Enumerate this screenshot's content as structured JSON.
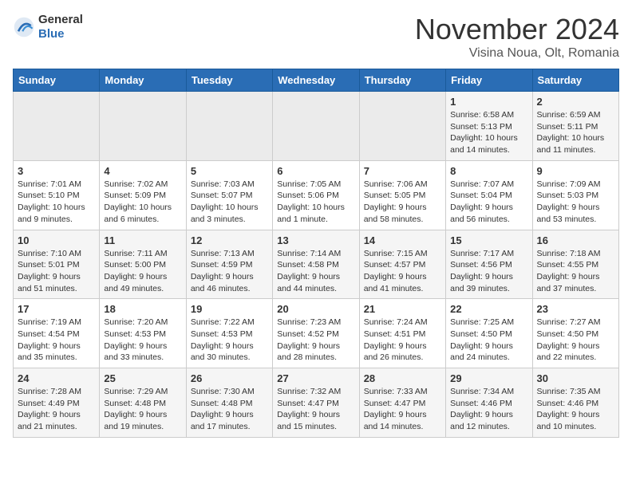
{
  "header": {
    "logo_general": "General",
    "logo_blue": "Blue",
    "title": "November 2024",
    "subtitle": "Visina Noua, Olt, Romania"
  },
  "days_of_week": [
    "Sunday",
    "Monday",
    "Tuesday",
    "Wednesday",
    "Thursday",
    "Friday",
    "Saturday"
  ],
  "weeks": [
    [
      {
        "day": "",
        "info": ""
      },
      {
        "day": "",
        "info": ""
      },
      {
        "day": "",
        "info": ""
      },
      {
        "day": "",
        "info": ""
      },
      {
        "day": "",
        "info": ""
      },
      {
        "day": "1",
        "info": "Sunrise: 6:58 AM\nSunset: 5:13 PM\nDaylight: 10 hours and 14 minutes."
      },
      {
        "day": "2",
        "info": "Sunrise: 6:59 AM\nSunset: 5:11 PM\nDaylight: 10 hours and 11 minutes."
      }
    ],
    [
      {
        "day": "3",
        "info": "Sunrise: 7:01 AM\nSunset: 5:10 PM\nDaylight: 10 hours and 9 minutes."
      },
      {
        "day": "4",
        "info": "Sunrise: 7:02 AM\nSunset: 5:09 PM\nDaylight: 10 hours and 6 minutes."
      },
      {
        "day": "5",
        "info": "Sunrise: 7:03 AM\nSunset: 5:07 PM\nDaylight: 10 hours and 3 minutes."
      },
      {
        "day": "6",
        "info": "Sunrise: 7:05 AM\nSunset: 5:06 PM\nDaylight: 10 hours and 1 minute."
      },
      {
        "day": "7",
        "info": "Sunrise: 7:06 AM\nSunset: 5:05 PM\nDaylight: 9 hours and 58 minutes."
      },
      {
        "day": "8",
        "info": "Sunrise: 7:07 AM\nSunset: 5:04 PM\nDaylight: 9 hours and 56 minutes."
      },
      {
        "day": "9",
        "info": "Sunrise: 7:09 AM\nSunset: 5:03 PM\nDaylight: 9 hours and 53 minutes."
      }
    ],
    [
      {
        "day": "10",
        "info": "Sunrise: 7:10 AM\nSunset: 5:01 PM\nDaylight: 9 hours and 51 minutes."
      },
      {
        "day": "11",
        "info": "Sunrise: 7:11 AM\nSunset: 5:00 PM\nDaylight: 9 hours and 49 minutes."
      },
      {
        "day": "12",
        "info": "Sunrise: 7:13 AM\nSunset: 4:59 PM\nDaylight: 9 hours and 46 minutes."
      },
      {
        "day": "13",
        "info": "Sunrise: 7:14 AM\nSunset: 4:58 PM\nDaylight: 9 hours and 44 minutes."
      },
      {
        "day": "14",
        "info": "Sunrise: 7:15 AM\nSunset: 4:57 PM\nDaylight: 9 hours and 41 minutes."
      },
      {
        "day": "15",
        "info": "Sunrise: 7:17 AM\nSunset: 4:56 PM\nDaylight: 9 hours and 39 minutes."
      },
      {
        "day": "16",
        "info": "Sunrise: 7:18 AM\nSunset: 4:55 PM\nDaylight: 9 hours and 37 minutes."
      }
    ],
    [
      {
        "day": "17",
        "info": "Sunrise: 7:19 AM\nSunset: 4:54 PM\nDaylight: 9 hours and 35 minutes."
      },
      {
        "day": "18",
        "info": "Sunrise: 7:20 AM\nSunset: 4:53 PM\nDaylight: 9 hours and 33 minutes."
      },
      {
        "day": "19",
        "info": "Sunrise: 7:22 AM\nSunset: 4:53 PM\nDaylight: 9 hours and 30 minutes."
      },
      {
        "day": "20",
        "info": "Sunrise: 7:23 AM\nSunset: 4:52 PM\nDaylight: 9 hours and 28 minutes."
      },
      {
        "day": "21",
        "info": "Sunrise: 7:24 AM\nSunset: 4:51 PM\nDaylight: 9 hours and 26 minutes."
      },
      {
        "day": "22",
        "info": "Sunrise: 7:25 AM\nSunset: 4:50 PM\nDaylight: 9 hours and 24 minutes."
      },
      {
        "day": "23",
        "info": "Sunrise: 7:27 AM\nSunset: 4:50 PM\nDaylight: 9 hours and 22 minutes."
      }
    ],
    [
      {
        "day": "24",
        "info": "Sunrise: 7:28 AM\nSunset: 4:49 PM\nDaylight: 9 hours and 21 minutes."
      },
      {
        "day": "25",
        "info": "Sunrise: 7:29 AM\nSunset: 4:48 PM\nDaylight: 9 hours and 19 minutes."
      },
      {
        "day": "26",
        "info": "Sunrise: 7:30 AM\nSunset: 4:48 PM\nDaylight: 9 hours and 17 minutes."
      },
      {
        "day": "27",
        "info": "Sunrise: 7:32 AM\nSunset: 4:47 PM\nDaylight: 9 hours and 15 minutes."
      },
      {
        "day": "28",
        "info": "Sunrise: 7:33 AM\nSunset: 4:47 PM\nDaylight: 9 hours and 14 minutes."
      },
      {
        "day": "29",
        "info": "Sunrise: 7:34 AM\nSunset: 4:46 PM\nDaylight: 9 hours and 12 minutes."
      },
      {
        "day": "30",
        "info": "Sunrise: 7:35 AM\nSunset: 4:46 PM\nDaylight: 9 hours and 10 minutes."
      }
    ]
  ]
}
